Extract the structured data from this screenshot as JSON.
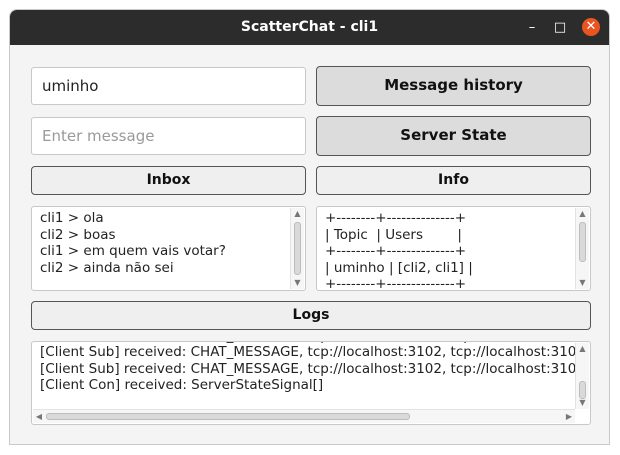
{
  "window": {
    "title": "ScatterChat - cli1",
    "controls": {
      "minimize": "–",
      "maximize": "□",
      "close": "✕"
    }
  },
  "topic_input": {
    "value": "uminho"
  },
  "message_input": {
    "placeholder": "Enter message"
  },
  "buttons": {
    "message_history": "Message history",
    "server_state": "Server State",
    "inbox": "Inbox",
    "info": "Info",
    "logs": "Logs"
  },
  "inbox": {
    "lines": [
      "cli1 > ola",
      "cli2 > boas",
      "cli1 > em quem vais votar?",
      "cli2 > ainda não sei"
    ]
  },
  "info": {
    "lines": [
      "+--------+--------------+",
      "| Topic  | Users        |",
      "+--------+--------------+",
      "| uminho | [cli2, cli1] |",
      "+--------+--------------+"
    ]
  },
  "logs": {
    "lines": [
      "[Client Sub] received: CHAT_MESSAGE, tcp://localhost:3102, tcp://localhost:3101, cli1, ola",
      "[Client Sub] received: CHAT_MESSAGE, tcp://localhost:3102, tcp://localhost:3101, cli2, boas",
      "[Client Sub] received: CHAT_MESSAGE, tcp://localhost:3102, tcp://localhost:3101, cli1, em quem vais votar?",
      "[Client Sub] received: CHAT_MESSAGE, tcp://localhost:3102, tcp://localhost:3101, cli2, ainda não sei",
      "[Client Con] received: ServerStateSignal[]"
    ]
  },
  "icons": {
    "scroll_up": "▲",
    "scroll_down": "▼",
    "scroll_left": "◀",
    "scroll_right": "▶"
  },
  "colors": {
    "titlebar": "#2c2c2c",
    "close_button": "#e95420",
    "button_fill": "#dcdcdc"
  }
}
